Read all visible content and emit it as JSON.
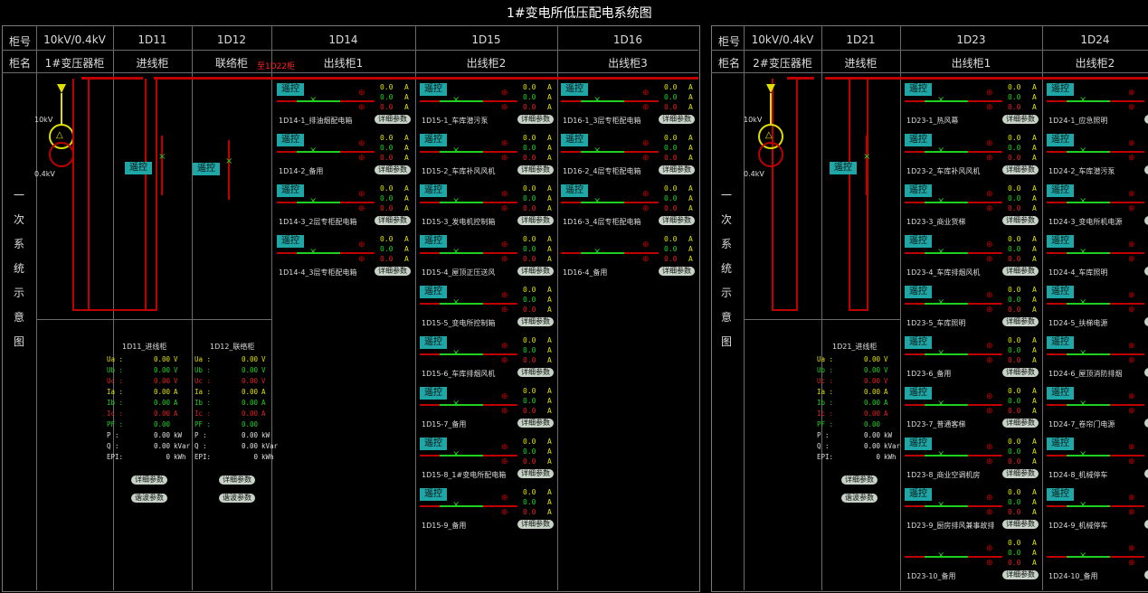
{
  "title": "1#变电所低压配电系统图",
  "left": {
    "row1_head": "柜号",
    "row2_head": "柜名",
    "side_label": [
      "一",
      "次",
      "系",
      "统",
      "示",
      "意",
      "图"
    ],
    "cabinets": [
      {
        "no": "10kV/0.4kV",
        "name": "1#变压器柜"
      },
      {
        "no": "1D11",
        "name": "进线柜"
      },
      {
        "no": "1D12",
        "name": "联络柜"
      },
      {
        "no": "1D14",
        "name": "出线柜1"
      },
      {
        "no": "1D15",
        "name": "出线柜2"
      },
      {
        "no": "1D16",
        "name": "出线柜3"
      }
    ],
    "tie_label": "至1D22柜",
    "trafo_hv": "10kV",
    "trafo_lv": "0.4kV",
    "remote": "遥控",
    "panels": [
      {
        "title": "1D11_进线柜",
        "buttons": [
          "详细参数",
          "谐波参数"
        ]
      },
      {
        "title": "1D12_联络柜",
        "buttons": [
          "详细参数",
          "谐波参数"
        ]
      }
    ],
    "measure_rows": [
      {
        "label": "Ua :",
        "value": "0.00",
        "unit": "V",
        "color": "#e0e000"
      },
      {
        "label": "Ub :",
        "value": "0.00",
        "unit": "V",
        "color": "#20d020"
      },
      {
        "label": "Uc :",
        "value": "0.00",
        "unit": "V",
        "color": "#e02020"
      },
      {
        "label": "Ia :",
        "value": "0.00",
        "unit": "A",
        "color": "#e0e000"
      },
      {
        "label": "Ib :",
        "value": "0.00",
        "unit": "A",
        "color": "#20d020"
      },
      {
        "label": "Ic :",
        "value": "0.00",
        "unit": "A",
        "color": "#e02020"
      },
      {
        "label": "PF :",
        "value": "0.00",
        "unit": "",
        "color": "#20d020"
      },
      {
        "label": "P  :",
        "value": "0.00",
        "unit": "kW",
        "color": "#e0e0e0"
      },
      {
        "label": "Q  :",
        "value": "0.00",
        "unit": "kVar",
        "color": "#e0e0e0"
      },
      {
        "label": "EPI:",
        "value": "0",
        "unit": "kWh",
        "color": "#e0e0e0"
      }
    ],
    "cols": [
      {
        "circuits": [
          "1D14-1_排油烟配电箱",
          "1D14-2_备用",
          "1D14-3_2层专柜配电箱",
          "1D14-4_3层专柜配电箱"
        ]
      },
      {
        "circuits": [
          "1D15-1_车库潜污泵",
          "1D15-2_车库补风风机",
          "1D15-3_发电机控制箱",
          "1D15-4_屋顶正压送风",
          "1D15-5_变电所控制箱",
          "1D15-6_车库排烟风机",
          "1D15-7_备用",
          "1D15-8_1#变电所配电箱",
          "1D15-9_备用"
        ]
      },
      {
        "circuits": [
          "1D16-1_3层专柜配电箱",
          "1D16-2_4层专柜配电箱",
          "1D16-3_4层专柜配电箱",
          "1D16-4_备用"
        ]
      }
    ]
  },
  "right": {
    "row1_head": "柜号",
    "row2_head": "柜名",
    "side_label": [
      "一",
      "次",
      "系",
      "统",
      "示",
      "意",
      "图"
    ],
    "cabinets": [
      {
        "no": "10kV/0.4kV",
        "name": "2#变压器柜"
      },
      {
        "no": "1D21",
        "name": "进线柜"
      },
      {
        "no": "1D23",
        "name": "出线柜1"
      },
      {
        "no": "1D24",
        "name": "出线柜2"
      }
    ],
    "trafo_hv": "10kV",
    "trafo_lv": "0.4kV",
    "panel": {
      "title": "1D21_进线柜",
      "buttons": [
        "详细参数",
        "谐波参数"
      ]
    },
    "cols": [
      {
        "circuits": [
          "1D23-1_热风幕",
          "1D23-2_车库补风风机",
          "1D23-3_商业货梯",
          "1D23-4_车库排烟风机",
          "1D23-5_车库照明",
          "1D23-6_备用",
          "1D23-7_普通客梯",
          "1D23-8_商业空调机房",
          "1D23-9_厨房排风兼事故排",
          "1D23-10_备用"
        ]
      },
      {
        "circuits": [
          "1D24-1_应急照明",
          "1D24-2_车库潜污泵",
          "1D24-3_变电所机电源",
          "1D24-4_车库照明",
          "1D24-5_扶梯电源",
          "1D24-6_屋顶消防排烟",
          "1D24-7_卷帘门电源",
          "1D24-8_机械停车",
          "1D24-9_机械停车",
          "1D24-10_备用"
        ]
      }
    ]
  },
  "circuit_values": [
    "0.0",
    "0.0",
    "0.0"
  ],
  "circuit_unit": "A",
  "detail_btn": "详细参数",
  "colors": {
    "yellow": "#e0e000",
    "green": "#20d020",
    "red": "#e02020",
    "teal": "#1fa6a6",
    "bus": "#c00000"
  }
}
